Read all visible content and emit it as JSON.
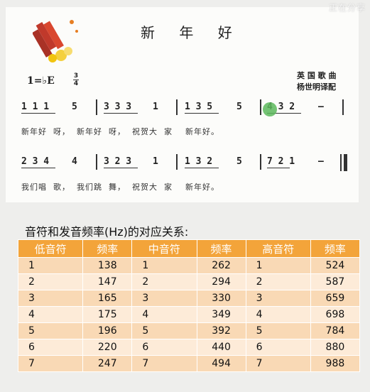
{
  "watermark": "正在分享",
  "score": {
    "title": "新 年 好",
    "key": "1=♭E",
    "meter_top": "3",
    "meter_bottom": "4",
    "credit_line1": "英 国 歌 曲",
    "credit_line2": "杨世明译配",
    "line1_notes": [
      "1 1 1",
      "5",
      "3 3 3",
      "1",
      "1 3 5",
      "5",
      "4 3 2",
      "–"
    ],
    "line1_lyrics": "新年好  呀，  新年好  呀，  祝贺大  家    新年好。",
    "line2_notes": [
      "2 3 4",
      "4",
      "3 2 3",
      "1",
      "1 3 2",
      "5",
      "7 2 1",
      "–"
    ],
    "line2_lyrics": "我们唱  歌，  我们跳  舞，  祝贺大  家    新年好。"
  },
  "heading": "音符和发音频率(Hz)的对应关系:",
  "table": {
    "headers": [
      "低音符",
      "频率",
      "中音符",
      "频率",
      "高音符",
      "频率"
    ],
    "rows": [
      [
        "1",
        "138",
        "1",
        "262",
        "1",
        "524"
      ],
      [
        "2",
        "147",
        "2",
        "294",
        "2",
        "587"
      ],
      [
        "3",
        "165",
        "3",
        "330",
        "3",
        "659"
      ],
      [
        "4",
        "175",
        "4",
        "349",
        "4",
        "698"
      ],
      [
        "5",
        "196",
        "5",
        "392",
        "5",
        "784"
      ],
      [
        "6",
        "220",
        "6",
        "440",
        "6",
        "880"
      ],
      [
        "7",
        "247",
        "7",
        "494",
        "7",
        "988"
      ]
    ]
  },
  "colors": {
    "header_bg": "#f3a43a",
    "row_odd": "#f9d9b5",
    "row_even": "#fdebd8",
    "cursor": "#5cb85c"
  }
}
